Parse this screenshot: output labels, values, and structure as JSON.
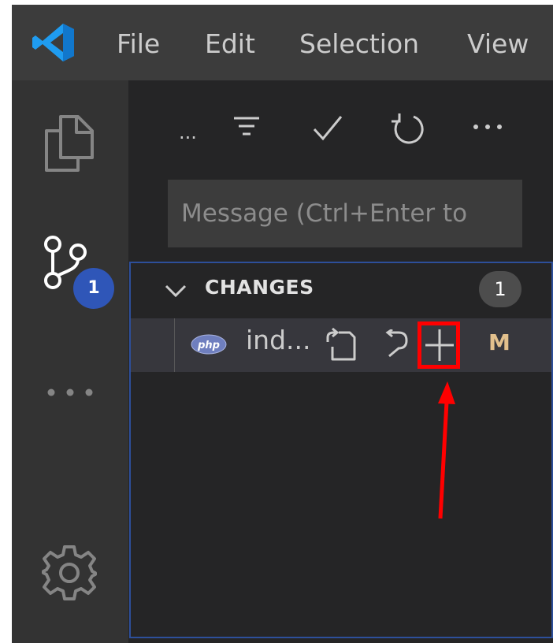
{
  "menu": {
    "items": [
      {
        "label": "File"
      },
      {
        "label": "Edit"
      },
      {
        "label": "Selection"
      },
      {
        "label": "View"
      }
    ]
  },
  "activity_bar": {
    "items": [
      {
        "icon": "files-icon"
      },
      {
        "icon": "source-control-icon",
        "badge": "1"
      },
      {
        "icon": "more-icon"
      },
      {
        "icon": "gear-icon"
      }
    ]
  },
  "scm": {
    "toolbar": {
      "ellipsis_label": "...",
      "icons": [
        "filter-icon",
        "check-icon",
        "refresh-icon",
        "more-actions-icon"
      ]
    },
    "message_input": {
      "placeholder": "Message (Ctrl+Enter to",
      "value": ""
    },
    "changes": {
      "title": "CHANGES",
      "count": "1",
      "files": [
        {
          "name": "ind...",
          "file_icon": "php-icon",
          "status": "M",
          "actions": [
            "open-file-icon",
            "discard-icon",
            "stage-plus-icon"
          ]
        }
      ]
    }
  },
  "colors": {
    "titlebar": "#3c3c3c",
    "activitybar": "#333333",
    "sidebar": "#252526",
    "badge": "#2f56b8",
    "status_modified": "#e2c08d",
    "highlight": "#ff0000"
  }
}
